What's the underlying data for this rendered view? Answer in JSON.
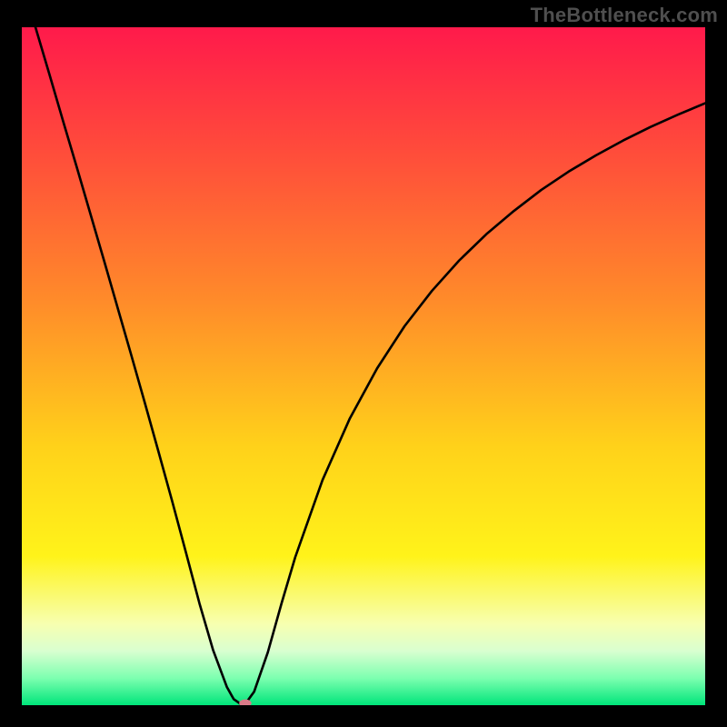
{
  "attribution": "TheBottleneck.com",
  "chart_data": {
    "type": "line",
    "title": "",
    "xlabel": "",
    "ylabel": "",
    "xlim": [
      0,
      100
    ],
    "ylim": [
      0,
      100
    ],
    "grid": false,
    "legend": false,
    "gradient_stops": [
      {
        "pct": 0,
        "color": "#ff1a4b"
      },
      {
        "pct": 18,
        "color": "#ff4b3b"
      },
      {
        "pct": 40,
        "color": "#ff8a2a"
      },
      {
        "pct": 62,
        "color": "#ffd21a"
      },
      {
        "pct": 78,
        "color": "#fff31a"
      },
      {
        "pct": 88,
        "color": "#f7ffb0"
      },
      {
        "pct": 92,
        "color": "#d9ffd0"
      },
      {
        "pct": 96,
        "color": "#7dffb0"
      },
      {
        "pct": 100,
        "color": "#00e57a"
      }
    ],
    "x": [
      0,
      2,
      4,
      6,
      8,
      10,
      12,
      14,
      16,
      18,
      20,
      22,
      24,
      26,
      28,
      30,
      31,
      32,
      33,
      34,
      36,
      38,
      40,
      44,
      48,
      52,
      56,
      60,
      64,
      68,
      72,
      76,
      80,
      84,
      88,
      92,
      96,
      100
    ],
    "series": [
      {
        "name": "bottleneck-curve",
        "values": [
          107,
          100,
          93.2,
          86.3,
          79.5,
          72.6,
          65.7,
          58.7,
          51.7,
          44.6,
          37.4,
          30.1,
          22.6,
          15.0,
          8.1,
          2.7,
          0.9,
          0.2,
          0.6,
          2.0,
          7.8,
          15.0,
          21.8,
          33.2,
          42.3,
          49.7,
          55.9,
          61.1,
          65.6,
          69.5,
          72.9,
          76.0,
          78.7,
          81.1,
          83.3,
          85.3,
          87.1,
          88.8
        ]
      }
    ],
    "marker": {
      "x": 32.7,
      "y": 0.3,
      "color": "#d97a88",
      "radius": 0.9
    }
  }
}
